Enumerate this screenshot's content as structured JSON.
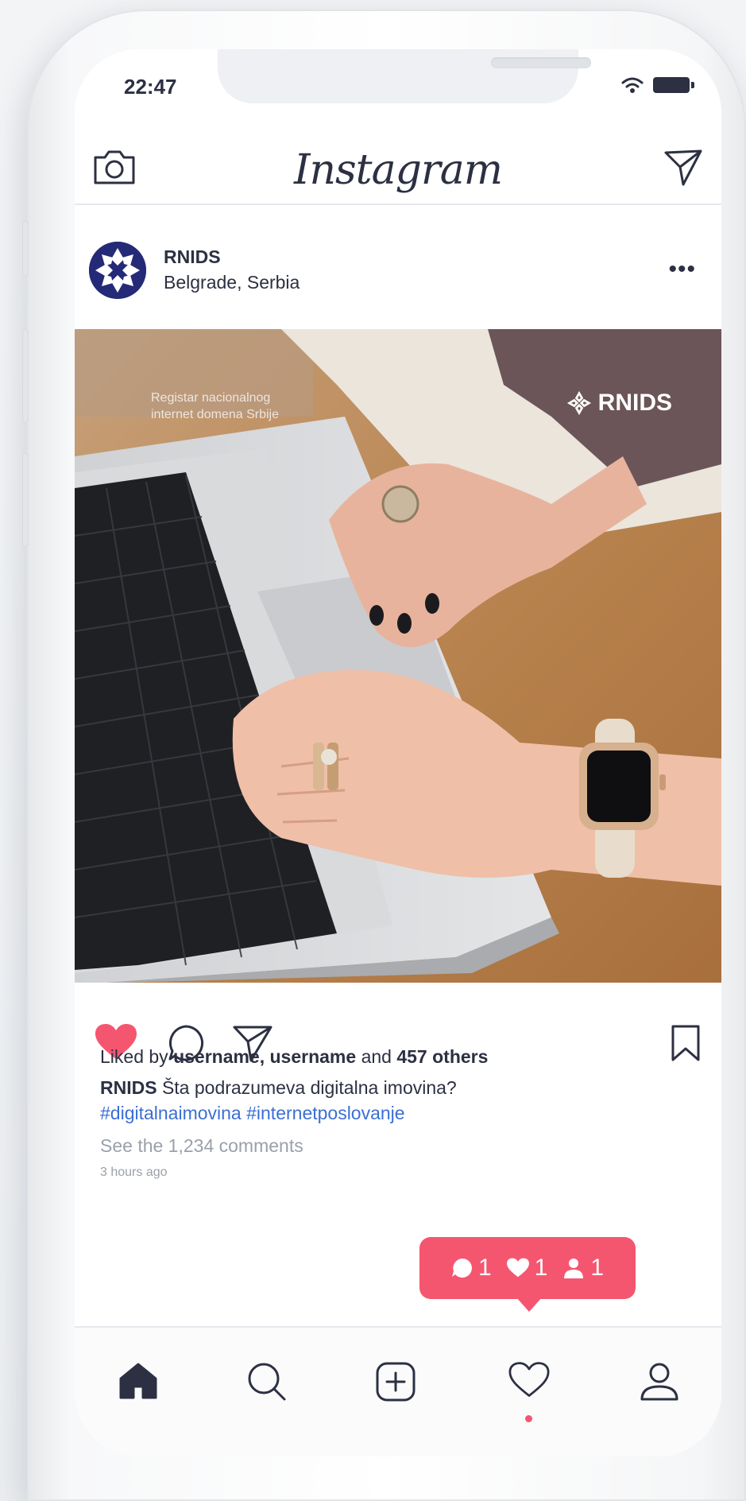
{
  "status": {
    "time": "22:47"
  },
  "app": {
    "title": "Instagram"
  },
  "post": {
    "username": "RNIDS",
    "location": "Belgrade, Serbia",
    "image_overlay": {
      "subtitle_line1": "Registar nacionalnog",
      "subtitle_line2": "internet domena Srbije",
      "brand": "RNIDS"
    },
    "likes": {
      "prefix": "Liked by ",
      "users": "username, username",
      "middle": " and ",
      "others": "457 others"
    },
    "caption": {
      "author": "RNIDS",
      "text": " Šta podrazumeva digitalna imovina?",
      "tags": "#digitalnaimovina #internetposlovanje"
    },
    "comments_link": "See the 1,234 comments",
    "time_ago": "3 hours ago"
  },
  "notification": {
    "comments": "1",
    "likes": "1",
    "followers": "1"
  },
  "colors": {
    "accent": "#f5566f",
    "text": "#2c3042",
    "link": "#3b6fd4"
  },
  "icons": [
    "camera-icon",
    "direct-message-icon",
    "more-icon",
    "heart-icon",
    "comment-icon",
    "share-icon",
    "bookmark-icon",
    "home-icon",
    "search-icon",
    "add-icon",
    "activity-icon",
    "profile-icon"
  ]
}
